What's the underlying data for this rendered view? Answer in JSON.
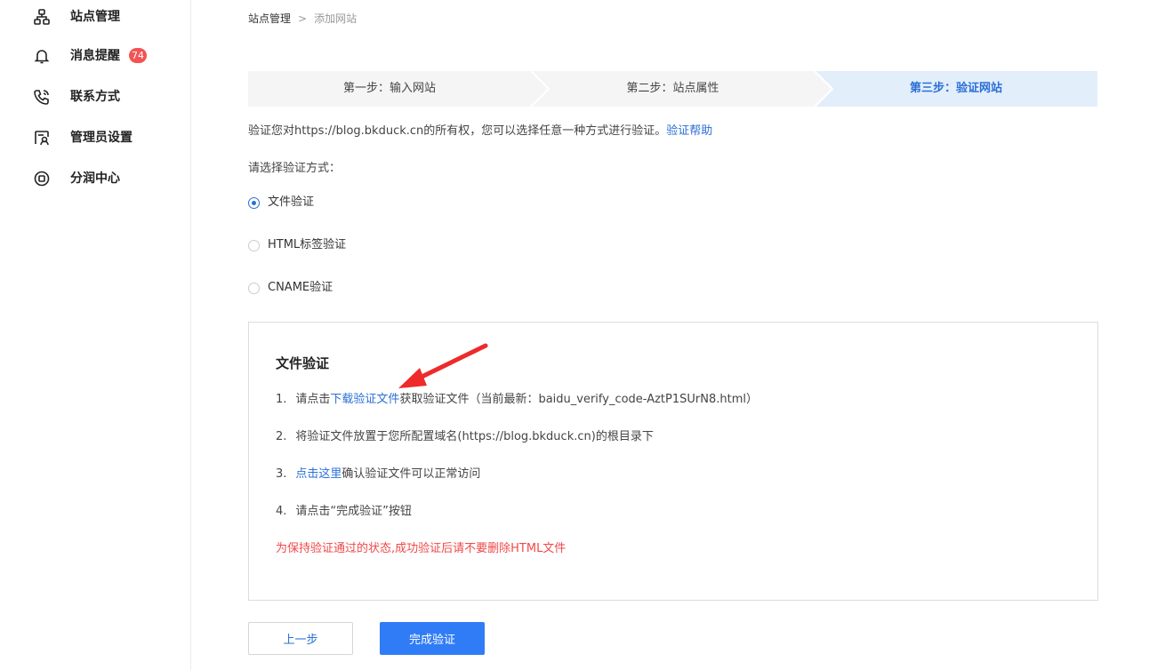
{
  "sidebar": {
    "items": [
      {
        "label": "站点管理",
        "icon": "sitemap-icon"
      },
      {
        "label": "消息提醒",
        "icon": "bell-icon",
        "badge": "74"
      },
      {
        "label": "联系方式",
        "icon": "phone-icon"
      },
      {
        "label": "管理员设置",
        "icon": "admin-settings-icon"
      },
      {
        "label": "分润中心",
        "icon": "profit-share-icon"
      }
    ]
  },
  "breadcrumb": {
    "root": "站点管理",
    "separator": ">",
    "current": "添加网站"
  },
  "steps": [
    {
      "label": "第一步：输入网站",
      "active": false
    },
    {
      "label": "第二步：站点属性",
      "active": false
    },
    {
      "label": "第三步：验证网站",
      "active": true
    }
  ],
  "description": {
    "text": "验证您对https://blog.bkduck.cn的所有权，您可以选择任意一种方式进行验证。",
    "help_link": "验证帮助"
  },
  "method": {
    "label": "请选择验证方式：",
    "options": [
      {
        "label": "文件验证",
        "checked": true
      },
      {
        "label": "HTML标签验证",
        "checked": false
      },
      {
        "label": "CNAME验证",
        "checked": false
      }
    ]
  },
  "panel": {
    "title": "文件验证",
    "steps": [
      {
        "num": "1.",
        "prefix": "请点击",
        "link": "下载验证文件",
        "suffix": "获取验证文件（当前最新：baidu_verify_code-AztP1SUrN8.html）"
      },
      {
        "num": "2.",
        "text": "将验证文件放置于您所配置域名(https://blog.bkduck.cn)的根目录下"
      },
      {
        "num": "3.",
        "link": "点击这里",
        "suffix": "确认验证文件可以正常访问"
      },
      {
        "num": "4.",
        "text": "请点击“完成验证”按钮"
      }
    ],
    "warning": "为保持验证通过的状态,成功验证后请不要删除HTML文件"
  },
  "buttons": {
    "prev": "上一步",
    "done": "完成验证"
  },
  "colors": {
    "accent": "#2a6fd6",
    "primary_button": "#2f7cf6",
    "warning": "#f04848",
    "badge": "#f25454",
    "annotation_arrow": "#ee2a2a",
    "active_step_bg": "#e3eefb",
    "step_bg": "#f5f5f5"
  }
}
